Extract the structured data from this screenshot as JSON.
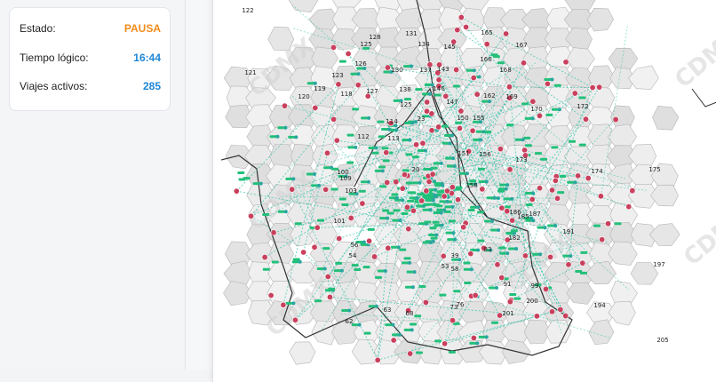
{
  "status_panel": {
    "rows": [
      {
        "label": "Estado:",
        "value": "PAUSA",
        "color": "#f28c1b"
      },
      {
        "label": "Tiempo lógico:",
        "value": "16:44",
        "color": "#1f86d6"
      },
      {
        "label": "Viajes activos:",
        "value": "285",
        "color": "#1f86d6"
      }
    ]
  },
  "map": {
    "colors": {
      "route": "#2ec4a8",
      "vehicle": "#22c07a",
      "stop": "#c9405d",
      "zone_fill": "#e6e6e6",
      "zone_stroke": "#b5b5b5",
      "boundary": "#333333"
    },
    "zone_labels": [
      "122",
      "121",
      "125",
      "128",
      "131",
      "134",
      "145",
      "165",
      "167",
      "126",
      "130",
      "137",
      "143",
      "166",
      "168",
      "123",
      "119",
      "127",
      "138",
      "146",
      "162",
      "169",
      "120",
      "118",
      "125",
      "147",
      "172",
      "170",
      "114",
      "23",
      "150",
      "155",
      "112",
      "113",
      "151",
      "156",
      "109",
      "173",
      "158",
      "100",
      "20",
      "175",
      "174",
      "103",
      "186",
      "101",
      "187",
      "185",
      "191",
      "56",
      "54",
      "83",
      "182",
      "197",
      "58",
      "39",
      "53",
      "91",
      "99",
      "200",
      "201",
      "63",
      "62",
      "68",
      "73",
      "76",
      "194",
      "205"
    ],
    "watermark": "CDMX"
  }
}
